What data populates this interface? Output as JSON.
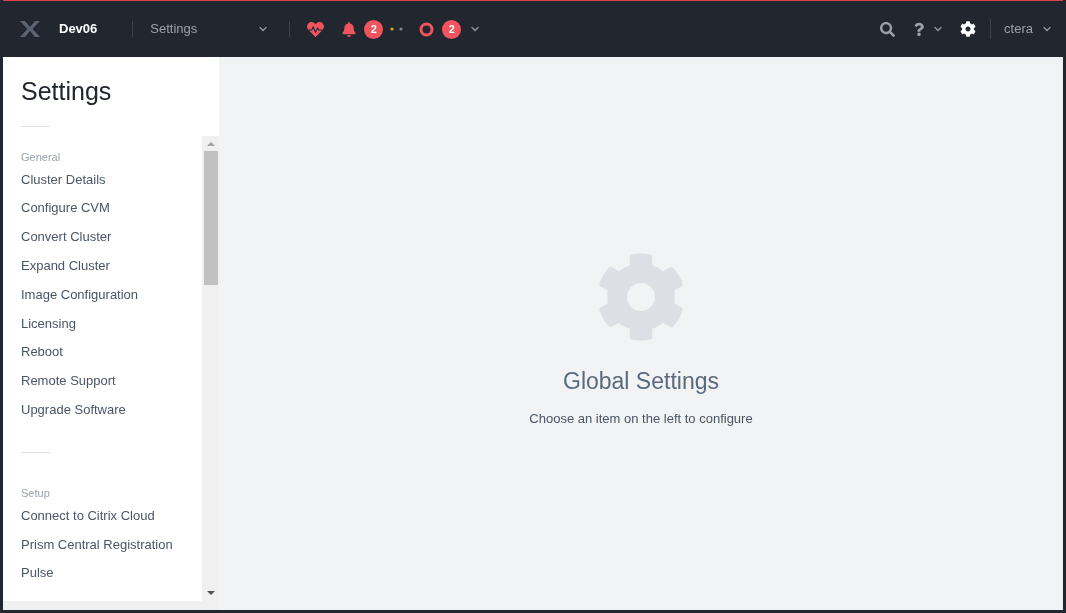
{
  "header": {
    "cluster": "Dev06",
    "menu": "Settings",
    "alert_count": "2",
    "task_count": "2",
    "user": "ctera"
  },
  "sidebar": {
    "title": "Settings",
    "sections": [
      {
        "heading": "General",
        "items": [
          "Cluster Details",
          "Configure CVM",
          "Convert Cluster",
          "Expand Cluster",
          "Image Configuration",
          "Licensing",
          "Reboot",
          "Remote Support",
          "Upgrade Software"
        ]
      },
      {
        "heading": "Setup",
        "items": [
          "Connect to Citrix Cloud",
          "Prism Central Registration",
          "Pulse"
        ]
      }
    ]
  },
  "main": {
    "title": "Global Settings",
    "subtitle": "Choose an item on the left to configure"
  }
}
